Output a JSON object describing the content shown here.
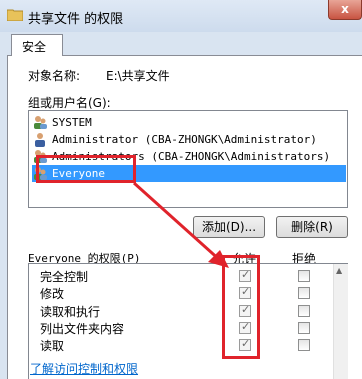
{
  "window": {
    "title": "共享文件 的权限",
    "close_label": "x"
  },
  "tabs": [
    {
      "label": "安全"
    }
  ],
  "object": {
    "label": "对象名称:",
    "value": "E:\\共享文件"
  },
  "groups": {
    "label": "组或用户名(G):",
    "items": [
      {
        "name": "SYSTEM",
        "selected": false
      },
      {
        "name": "Administrator (CBA-ZHONGK\\Administrator)",
        "selected": false
      },
      {
        "name": "Administrators (CBA-ZHONGK\\Administrators)",
        "selected": false
      },
      {
        "name": "Everyone",
        "selected": true
      }
    ]
  },
  "buttons": {
    "add": "添加(D)...",
    "remove": "删除(R)"
  },
  "permissions": {
    "header": "Everyone 的权限(P)",
    "allow_label": "允许",
    "deny_label": "拒绝",
    "rows": [
      {
        "name": "完全控制",
        "allow": true,
        "deny": false
      },
      {
        "name": "修改",
        "allow": true,
        "deny": false
      },
      {
        "name": "读取和执行",
        "allow": true,
        "deny": false
      },
      {
        "name": "列出文件夹内容",
        "allow": true,
        "deny": false
      },
      {
        "name": "读取",
        "allow": true,
        "deny": false
      }
    ]
  },
  "link": "了解访问控制和权限",
  "colors": {
    "selection": "#3399ff",
    "annotation_red": "#e0232b",
    "link": "#0066cc"
  }
}
